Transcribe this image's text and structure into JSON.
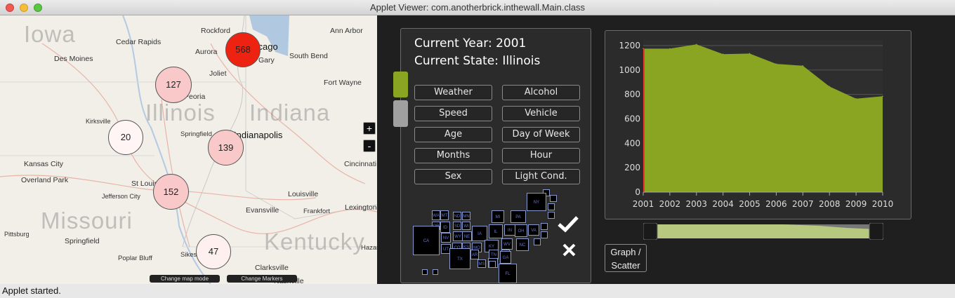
{
  "window": {
    "title": "Applet Viewer: com.anotherbrick.inthewall.Main.class",
    "status": "Applet started."
  },
  "map": {
    "state_labels": [
      "Iowa",
      "Illinois",
      "Indiana",
      "Missouri",
      "Kentucky"
    ],
    "cities": [
      "Cedar Rapids",
      "Rockford",
      "Chicago",
      "Ann Arbor",
      "Des Moines",
      "Aurora",
      "Gary",
      "South Bend",
      "Joliet",
      "Peoria",
      "Fort Wayne",
      "Kirksville",
      "Springfield",
      "Indianapolis",
      "Kansas City",
      "Overland Park",
      "St Louis",
      "Cincinnati",
      "Jefferson City",
      "Louisville",
      "Evansville",
      "Frankfort",
      "Lexington",
      "Pittsburg",
      "Springfield",
      "Poplar Bluff",
      "Sikeston",
      "Clarksville",
      "Hazard",
      "Nashville"
    ],
    "markers": [
      {
        "count": "568",
        "color": "#ee2211"
      },
      {
        "count": "127",
        "color": "#f9c9c9"
      },
      {
        "count": "20",
        "color": "#fff5f5"
      },
      {
        "count": "139",
        "color": "#f9c9c9"
      },
      {
        "count": "152",
        "color": "#f9c9c9"
      },
      {
        "count": "47",
        "color": "#fff0f0"
      }
    ],
    "zoom_in": "+",
    "zoom_out": "-",
    "change_map_mode": "Change map mode",
    "change_markers": "Change Markers"
  },
  "controls": {
    "current_year": "Current Year: 2001",
    "current_state": "Current State: Illinois",
    "categories": [
      "Weather",
      "Alcohol",
      "Speed",
      "Vehicle",
      "Age",
      "Day of Week",
      "Months",
      "Hour",
      "Sex",
      "Light Cond."
    ],
    "swatch_colors": [
      "#8aa521",
      "#a0a0a0"
    ],
    "state_tiles": [
      "WA",
      "MT",
      "ND",
      "MN",
      "MI",
      "ME",
      "NY",
      "VT",
      "OR",
      "ID",
      "SD",
      "WI",
      "PA",
      "NJ",
      "NH",
      "MA",
      "CA",
      "NV",
      "WY",
      "NE",
      "IA",
      "IL",
      "IN",
      "OH",
      "VA",
      "MD",
      "DE",
      "UT",
      "CO",
      "KS",
      "MO",
      "KY",
      "WV",
      "NC",
      "AZ",
      "NM",
      "OK",
      "AR",
      "TN",
      "SC",
      "TX",
      "LA",
      "MS",
      "AL",
      "GA",
      "FL",
      "AK",
      "HI"
    ]
  },
  "chart_data": {
    "type": "area",
    "x": [
      2001,
      2002,
      2003,
      2004,
      2005,
      2006,
      2007,
      2008,
      2009,
      2010
    ],
    "series": [
      {
        "values": [
          1175,
          1175,
          1210,
          1130,
          1135,
          1050,
          1035,
          865,
          765,
          785
        ]
      }
    ],
    "ylim": [
      0,
      1200
    ],
    "yticks": [
      0,
      200,
      400,
      600,
      800,
      1000,
      1200
    ],
    "fill_color": "#8aa521",
    "grid": true
  },
  "slider": {
    "range": [
      2001,
      2010
    ]
  },
  "graph_toggle": {
    "line1": "Graph /",
    "line2": "Scatter"
  }
}
